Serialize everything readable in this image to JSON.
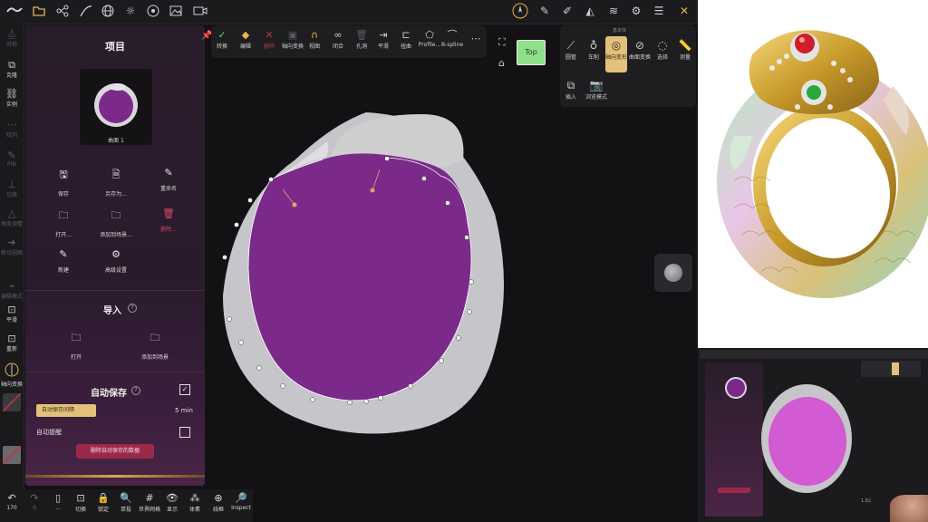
{
  "toolbar_top": {
    "icons": [
      "logo-icon",
      "folder-icon",
      "graph-icon",
      "curve-icon",
      "globe-icon",
      "sun-icon",
      "material-icon",
      "image-icon",
      "video-icon"
    ],
    "right_icons": [
      "compass-icon",
      "pen-icon",
      "paint-icon",
      "shape-icon",
      "layers-icon",
      "settings-icon",
      "sliders-icon",
      "close-tools-icon"
    ]
  },
  "left_tools": [
    {
      "label": "对称",
      "dim": true
    },
    {
      "label": "克隆",
      "dim": false
    },
    {
      "label": "实例",
      "dim": false
    },
    {
      "label": "阵列",
      "dim": true
    },
    {
      "label": "PIN",
      "dim": true
    },
    {
      "label": "切换",
      "dim": true
    },
    {
      "label": "角度调整",
      "dim": true
    },
    {
      "label": "移动视图",
      "dim": true
    },
    {
      "label": "编辑模式",
      "dim": true
    },
    {
      "label": "平滑",
      "dim": false
    },
    {
      "label": "重新",
      "dim": false
    },
    {
      "label": "轴向变换",
      "dim": false
    }
  ],
  "panel": {
    "title": "项目",
    "thumb_label": "曲面 1",
    "actions": [
      {
        "label": "保存",
        "icon": "save-icon",
        "glyph": "🖫",
        "red": false
      },
      {
        "label": "另存为...",
        "icon": "save-as-icon",
        "glyph": "🗎",
        "red": false
      },
      {
        "label": "重命名",
        "icon": "rename-icon",
        "glyph": "✎",
        "red": false
      },
      {
        "label": "打开...",
        "icon": "open-icon",
        "glyph": "🗀",
        "red": false
      },
      {
        "label": "添加到场景...",
        "icon": "add-scene-icon",
        "glyph": "🗀",
        "red": false
      },
      {
        "label": "删除...",
        "icon": "trash-icon",
        "glyph": "🗑",
        "red": true
      },
      {
        "label": "新建",
        "icon": "new-icon",
        "glyph": "✎",
        "red": false
      },
      {
        "label": "高级设置",
        "icon": "gear-icon",
        "glyph": "⚙",
        "red": false
      }
    ],
    "import_title": "导入",
    "import_actions": [
      {
        "label": "打开",
        "icon": "open-folder-icon",
        "glyph": "🗀"
      },
      {
        "label": "添加到场景",
        "icon": "add-to-scene-icon",
        "glyph": "🗀"
      }
    ],
    "autosave_title": "自动保存",
    "autosave_interval_label": "自动保存间隔",
    "autosave_interval_value": "5 min",
    "autosave_prompt_label": "自动提醒",
    "delete_autosave_label": "删除自动保存的数据"
  },
  "float_tools": [
    {
      "label": "转换",
      "glyph": "✓",
      "color": "#5fcf6e"
    },
    {
      "label": "编辑",
      "glyph": "◆",
      "color": "#e2b64a"
    },
    {
      "label": "删除",
      "glyph": "✕",
      "color": "#b23a48"
    },
    {
      "label": "轴向变换",
      "glyph": "▣",
      "color": "#5a5a5e"
    },
    {
      "label": "视图",
      "glyph": "∩",
      "color": "#e2b64a"
    },
    {
      "label": "闭合",
      "glyph": "∞",
      "color": "#d0d0d0"
    },
    {
      "label": "孔洞",
      "glyph": "🗑",
      "color": "#5a5a5e"
    },
    {
      "label": "平滑",
      "glyph": "⇥",
      "color": "#d0d0d0"
    },
    {
      "label": "扭曲",
      "glyph": "⊏",
      "color": "#d0d0d0"
    },
    {
      "label": "Profile...",
      "glyph": "⬠",
      "color": "#d0d0d0"
    },
    {
      "label": "B-spline",
      "glyph": "⌒",
      "color": "#d0d0d0"
    },
    {
      "label": "",
      "glyph": "⋯",
      "color": "#d0d0d0"
    }
  ],
  "view": {
    "top_label": "Top"
  },
  "right_tools": {
    "header": "基本体",
    "row1": [
      {
        "label": "圆管",
        "glyph": "⟋"
      },
      {
        "label": "车削",
        "glyph": "♁"
      },
      {
        "label": "轴向变形",
        "glyph": "◎"
      },
      {
        "label": "曲面变换",
        "glyph": "⊘"
      },
      {
        "label": "选择",
        "glyph": "◌"
      },
      {
        "label": "测量",
        "glyph": "📏"
      }
    ],
    "row2": [
      {
        "label": "插入",
        "glyph": "⧉"
      },
      {
        "label": "浏览模式",
        "glyph": "📷"
      }
    ]
  },
  "bottom_bar": [
    {
      "label": "170",
      "glyph": "↶"
    },
    {
      "label": "0",
      "glyph": "↷"
    },
    {
      "label": "...",
      "glyph": "▯"
    },
    {
      "label": "切换",
      "glyph": "⊡"
    },
    {
      "label": "锁定",
      "glyph": "🔒"
    },
    {
      "label": "单投",
      "glyph": "🔍"
    },
    {
      "label": "世界网格",
      "glyph": "#"
    },
    {
      "label": "显示",
      "glyph": "👁"
    },
    {
      "label": "体素",
      "glyph": "⁂"
    },
    {
      "label": "线框",
      "glyph": "⊕"
    },
    {
      "label": "Inspect",
      "glyph": "🔎"
    }
  ],
  "pip": {
    "corner_value": "1.82"
  },
  "colors": {
    "accent": "#e2b64a",
    "fill": "#7b2a8a",
    "panel": "#2a1d2b",
    "delete": "#9b2a4a"
  }
}
